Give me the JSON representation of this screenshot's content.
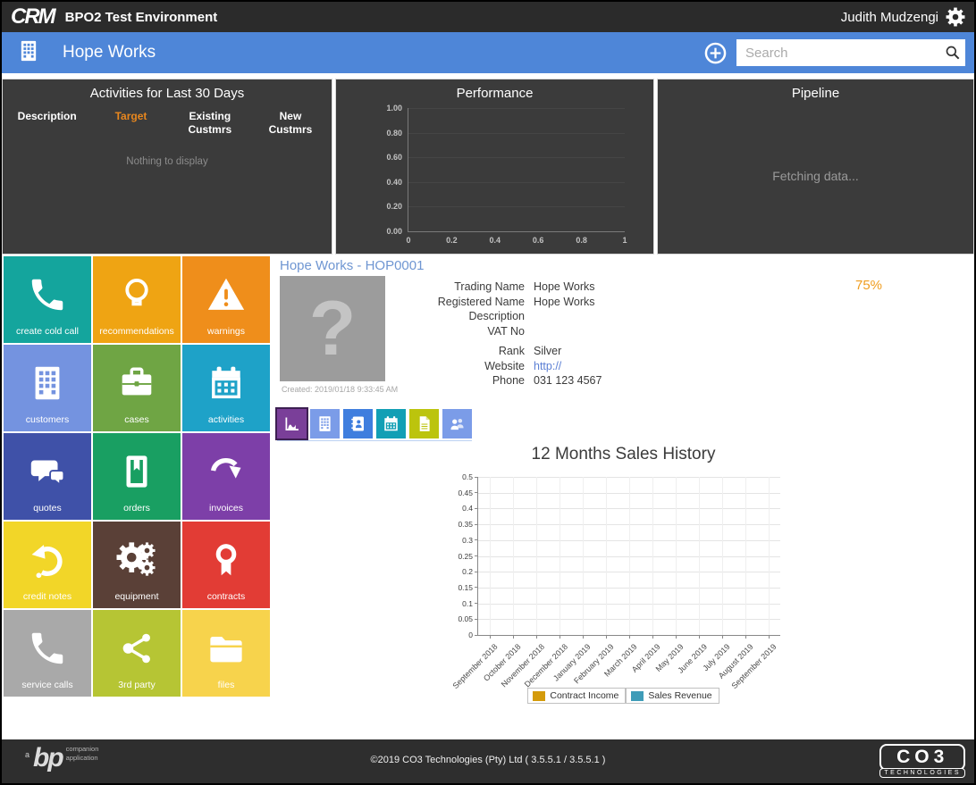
{
  "header": {
    "logo": "CRM",
    "title": "BPO2 Test Environment",
    "user": "Judith Mudzengi"
  },
  "toolbar": {
    "customer_name": "Hope Works",
    "search_placeholder": "Search"
  },
  "panels": {
    "activities": {
      "title": "Activities for Last 30 Days",
      "columns": [
        "Description",
        "Target",
        "Existing Custmrs",
        "New Custmrs"
      ],
      "target_color": "#e8871e",
      "empty_text": "Nothing to display"
    },
    "performance": {
      "title": "Performance"
    },
    "pipeline": {
      "title": "Pipeline",
      "status_text": "Fetching data..."
    }
  },
  "tiles": [
    {
      "label": "create cold call",
      "icon": "phone-icon",
      "color": "#14a59d"
    },
    {
      "label": "recommendations",
      "icon": "lightbulb-icon",
      "color": "#efa413"
    },
    {
      "label": "warnings",
      "icon": "warning-triangle-icon",
      "color": "#ef8e1b"
    },
    {
      "label": "customers",
      "icon": "building-icon",
      "color": "#7493e0"
    },
    {
      "label": "cases",
      "icon": "briefcase-icon",
      "color": "#6fa544"
    },
    {
      "label": "activities",
      "icon": "calendar-icon",
      "color": "#1ea2c8"
    },
    {
      "label": "quotes",
      "icon": "chat-bubbles-icon",
      "color": "#3f51a8"
    },
    {
      "label": "orders",
      "icon": "book-icon",
      "color": "#199f62"
    },
    {
      "label": "invoices",
      "icon": "curved-arrow-icon",
      "color": "#7d3fa8"
    },
    {
      "label": "credit notes",
      "icon": "undo-icon",
      "color": "#f2d628"
    },
    {
      "label": "equipment",
      "icon": "gears-icon",
      "color": "#5a4037"
    },
    {
      "label": "contracts",
      "icon": "award-icon",
      "color": "#e23c35"
    },
    {
      "label": "service calls",
      "icon": "phone-icon",
      "color": "#a9a9a9"
    },
    {
      "label": "3rd party",
      "icon": "share-icon",
      "color": "#b6c534"
    },
    {
      "label": "files",
      "icon": "folder-icon",
      "color": "#f7d34c"
    }
  ],
  "customer": {
    "heading": "Hope Works - HOP0001",
    "photo_placeholder": "?",
    "created": "Created:  2019/01/18 9:33:45 AM",
    "score": "75%",
    "field_groups": [
      [
        {
          "label": "Trading Name",
          "value": "Hope Works"
        },
        {
          "label": "Registered Name",
          "value": "Hope Works"
        },
        {
          "label": "Description",
          "value": ""
        },
        {
          "label": "VAT No",
          "value": ""
        }
      ],
      [
        {
          "label": "Rank",
          "value": "Silver"
        },
        {
          "label": "Website",
          "value": "http://",
          "link": true
        },
        {
          "label": "Phone",
          "value": "031 123 4567"
        }
      ]
    ]
  },
  "tabs": [
    {
      "name": "tab-sales-history",
      "icon": "chart-icon",
      "color": "#7a3f99",
      "active": true
    },
    {
      "name": "tab-customers",
      "icon": "building-icon",
      "color": "#7b9ce8",
      "active": false
    },
    {
      "name": "tab-contacts",
      "icon": "address-book-icon",
      "color": "#3f7ede",
      "active": false
    },
    {
      "name": "tab-activities",
      "icon": "calendar-icon",
      "color": "#129fb5",
      "active": false
    },
    {
      "name": "tab-documents",
      "icon": "document-icon",
      "color": "#bcc40d",
      "active": false
    },
    {
      "name": "tab-people",
      "icon": "people-icon",
      "color": "#7b9ce8",
      "active": false
    }
  ],
  "chart_data": [
    {
      "type": "bar",
      "title": "Performance",
      "series": [],
      "xlim": [
        0,
        1
      ],
      "ylim": [
        0,
        1
      ],
      "x_tick_labels": [
        "0",
        "0.2",
        "0.4",
        "0.6",
        "0.8",
        "1"
      ],
      "y_tick_labels": [
        "1.00",
        "0.80",
        "0.60",
        "0.40",
        "0.20",
        "0.00"
      ],
      "grid": true,
      "note": "empty chart, no data plotted"
    },
    {
      "type": "bar",
      "title": "12 Months Sales History",
      "categories": [
        "September 2018",
        "October 2018",
        "November 2018",
        "December 2018",
        "January 2019",
        "February 2019",
        "March 2019",
        "April 2019",
        "May 2019",
        "June 2019",
        "July 2019",
        "August 2019",
        "September 2019"
      ],
      "series": [
        {
          "name": "Contract Income",
          "color": "#d49b0b",
          "values": []
        },
        {
          "name": "Sales Revenue",
          "color": "#3f9cb8",
          "values": []
        }
      ],
      "ylim": [
        0,
        0.5
      ],
      "y_step": 0.05,
      "grid": true,
      "legend_position": "bottom",
      "note": "empty chart, no bars plotted"
    }
  ],
  "footer": {
    "bp_prefix": "a",
    "bp_name": "bp",
    "bp_sub1": "companion",
    "bp_sub2": "application",
    "copyright": "©2019 CO3 Technologies (Pty) Ltd ( 3.5.5.1 / 3.5.5.1 )",
    "co3_name": "CO3",
    "co3_sub": "TECHNOLOGIES"
  }
}
